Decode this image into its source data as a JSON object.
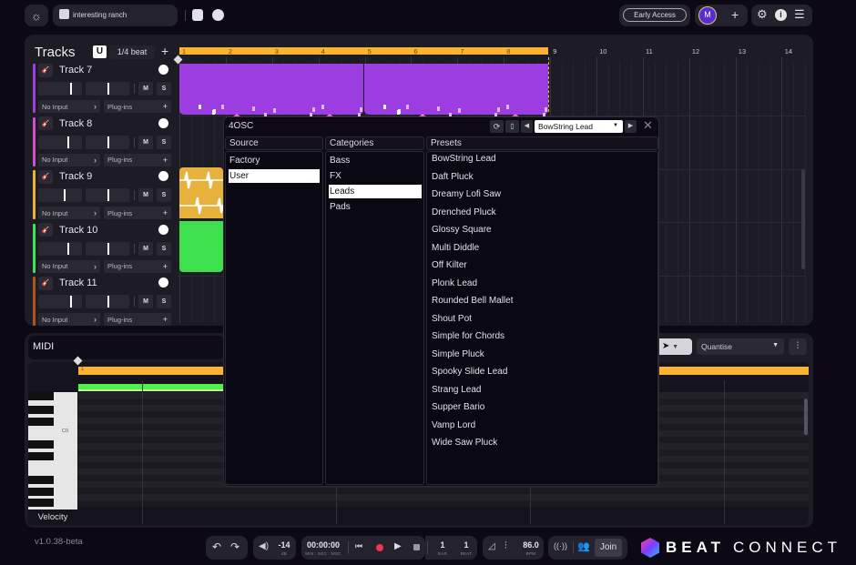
{
  "topbar": {
    "project_name": "interesting ranch",
    "early_access_label": "Early Access",
    "avatar_initial": "M",
    "accent_color": "#5b2bd6"
  },
  "tracks_panel": {
    "title": "Tracks",
    "snap_label": "1/4 beat",
    "tracks": [
      {
        "name": "Track 7",
        "color": "#9a3fe0",
        "input": "No Input",
        "plugins": "Plug-ins",
        "volume": 0.72,
        "pan": 0.5
      },
      {
        "name": "Track 8",
        "color": "#d04fc8",
        "input": "No Input",
        "plugins": "Plug-ins",
        "volume": 0.66,
        "pan": 0.5
      },
      {
        "name": "Track 9",
        "color": "#e6b23c",
        "input": "No Input",
        "plugins": "Plug-ins",
        "volume": 0.58,
        "pan": 0.5
      },
      {
        "name": "Track 10",
        "color": "#3ee05a",
        "input": "No Input",
        "plugins": "Plug-ins",
        "volume": 0.66,
        "pan": 0.5
      },
      {
        "name": "Track 11",
        "color": "#b0541e",
        "input": "No Input",
        "plugins": "Plug-ins",
        "volume": 0.72,
        "pan": 0.5
      }
    ],
    "mute_label": "M",
    "solo_label": "S"
  },
  "timeline": {
    "bars": [
      "1",
      "2",
      "3",
      "4",
      "5",
      "6",
      "7",
      "8",
      "9",
      "10",
      "11",
      "12",
      "13",
      "14"
    ],
    "loop_color": "#fbb331"
  },
  "osc_dialog": {
    "title": "4OSC",
    "selected_preset": "BowString Lead",
    "source_header": "Source",
    "categories_header": "Categories",
    "presets_header": "Presets",
    "sources": [
      "Factory",
      "User"
    ],
    "selected_source": "User",
    "categories": [
      "Bass",
      "FX",
      "Leads",
      "Pads"
    ],
    "selected_category": "Leads",
    "presets": [
      "BowString Lead",
      "Daft Pluck",
      "Dreamy Lofi Saw",
      "Drenched Pluck",
      "Glossy Square",
      "Multi Diddle",
      "Off Kilter",
      "Plonk Lead",
      "Rounded Bell Mallet",
      "Shout Pot",
      "Simple for Chords",
      "Simple Pluck",
      "Spooky Slide Lead",
      "Strang Lead",
      "Supper Bario",
      "Vamp Lord",
      "Wide Saw Pluck"
    ]
  },
  "midi_panel": {
    "title": "MIDI",
    "quantise_label": "Quantise",
    "bar_label": "1",
    "c0_label": "C0",
    "velocity_label": "Velocity"
  },
  "version": "v1.0.38-beta",
  "transport": {
    "volume_value": "-14",
    "volume_unit": "dB",
    "time_value": "00:00:00",
    "time_unit": "MIN : SEC : MSC",
    "bar_value": "1",
    "bar_label": "BAR",
    "beat_value": "1",
    "beat_label": "BEAT",
    "bpm_value": "86.0",
    "bpm_label": "BPM",
    "join_label": "Join"
  },
  "brand": {
    "bold": "BEAT",
    "light": "CONNECT"
  }
}
